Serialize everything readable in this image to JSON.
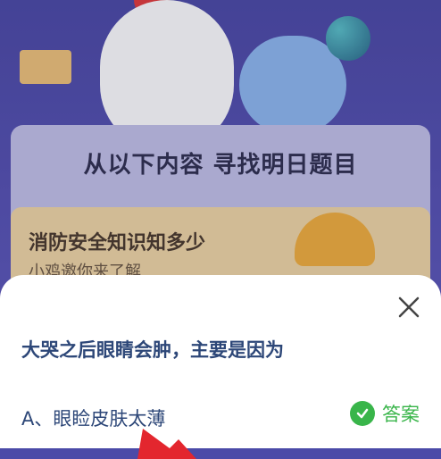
{
  "background": {
    "banner": "从以下内容 寻找明日题目",
    "topic_title": "消防安全知识知多少",
    "topic_subtitle": "小鸡邀你来了解"
  },
  "sheet": {
    "question": "大哭之后眼睛会肿，主要是因为",
    "option_a": "A、眼睑皮肤太薄",
    "answer_label": "答案"
  },
  "colors": {
    "accent_green": "#39b54a",
    "question_text": "#2d4778",
    "background_purple": "#4b4aa8"
  },
  "icons": {
    "close": "close-icon",
    "check": "check-circle-icon",
    "arrow": "red-arrow-icon"
  }
}
